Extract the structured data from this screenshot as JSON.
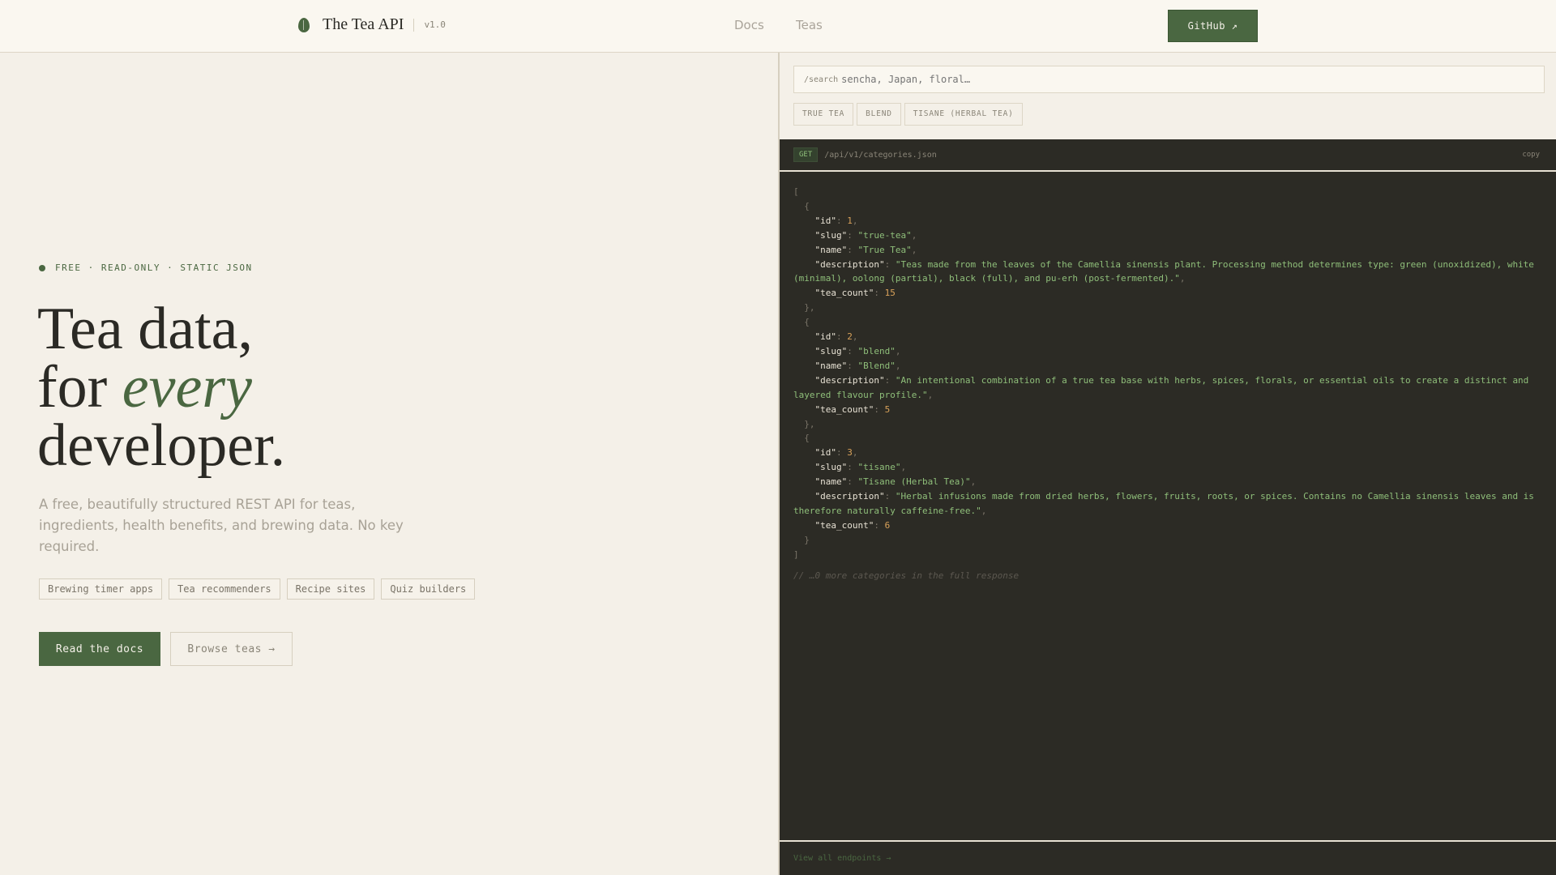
{
  "header": {
    "brand": "The Tea API",
    "version": "v1.0",
    "nav": [
      "Docs",
      "Teas"
    ],
    "github": "GitHub ↗"
  },
  "hero": {
    "tagline": "FREE · READ-ONLY · STATIC JSON",
    "title_1": "Tea data,",
    "title_2a": "for ",
    "title_2b": "every",
    "title_3": "developer.",
    "lead": "A free, beautifully structured REST API for teas, ingredients, health benefits, and brewing data. No key required.",
    "chips": [
      "Brewing timer apps",
      "Tea recommenders",
      "Recipe sites",
      "Quiz builders"
    ],
    "primary": "Read the docs",
    "secondary": "Browse teas →"
  },
  "search": {
    "label": "/search",
    "placeholder": "sencha, Japan, floral…",
    "categories": [
      "TRUE TEA",
      "BLEND",
      "TISANE (HERBAL TEA)"
    ]
  },
  "response": {
    "method": "GET",
    "path": "/api/v1/categories.json",
    "copy": "copy",
    "items": [
      {
        "id": 1,
        "slug": "true-tea",
        "name": "True Tea",
        "description": "Teas made from the leaves of the Camellia sinensis plant. Processing method determines type: green (unoxidized), white (minimal), oolong (partial), black (full), and pu-erh (post-fermented).",
        "tea_count": 15
      },
      {
        "id": 2,
        "slug": "blend",
        "name": "Blend",
        "description": "An intentional combination of a true tea base with herbs, spices, florals, or essential oils to create a distinct and layered flavour profile.",
        "tea_count": 5
      },
      {
        "id": 3,
        "slug": "tisane",
        "name": "Tisane (Herbal Tea)",
        "description": "Herbal infusions made from dried herbs, flowers, fruits, roots, or spices. Contains no Camellia sinensis leaves and is therefore naturally caffeine-free.",
        "tea_count": 6
      }
    ],
    "comment": "// …0 more categories in the full response",
    "footer_link": "View all endpoints →"
  },
  "colors": {
    "accent": "#4a6741",
    "code_bg": "#2c2b25",
    "string": "#8fbf7a",
    "number": "#d9a25a"
  }
}
